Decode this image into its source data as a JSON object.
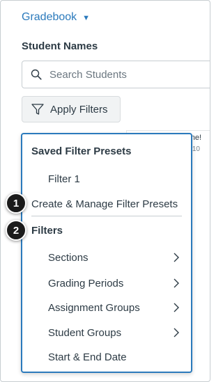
{
  "header": {
    "gradebook_label": "Gradebook",
    "student_names_label": "Student Names"
  },
  "search": {
    "placeholder": "Search Students"
  },
  "apply_filters": {
    "label": "Apply Filters"
  },
  "grid": {
    "column_label": "ne!",
    "column_sub": "10"
  },
  "menu": {
    "presets_heading": "Saved Filter Presets",
    "preset_items": [
      "Filter 1"
    ],
    "create_manage_label": "Create & Manage Filter Presets",
    "filters_heading": "Filters",
    "filter_items": [
      {
        "label": "Sections",
        "has_submenu": true
      },
      {
        "label": "Grading Periods",
        "has_submenu": true
      },
      {
        "label": "Assignment Groups",
        "has_submenu": true
      },
      {
        "label": "Student Groups",
        "has_submenu": true
      },
      {
        "label": "Start & End Date",
        "has_submenu": false
      }
    ]
  },
  "callouts": [
    "1",
    "2"
  ],
  "colors": {
    "accent": "#2b7abc",
    "text": "#2d3b45",
    "callout": "#1b1b1b"
  },
  "icons": {
    "gradebook_caret": "caret-down-icon",
    "search": "search-icon",
    "apply": "filter-funnel-icon",
    "submenu": "chevron-right-icon"
  }
}
